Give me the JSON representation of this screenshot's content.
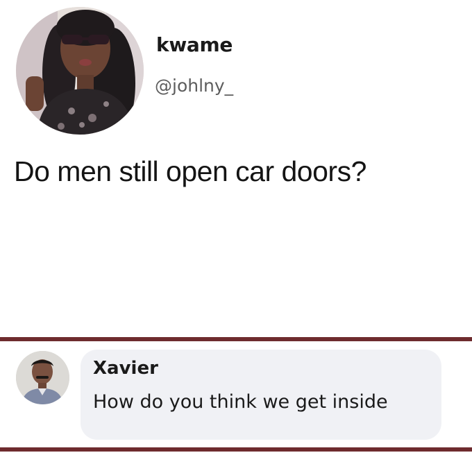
{
  "tweet": {
    "author_name": "kwame",
    "author_handle": "@johlny_",
    "text": "Do men still open car doors?",
    "avatar_icon": "user-avatar-photo"
  },
  "reply": {
    "author_name": "Xavier",
    "text": "How do you think we get inside",
    "avatar_icon": "user-avatar-photo"
  },
  "colors": {
    "divider": "#6e2b2e",
    "comment_bubble": "#f0f1f5",
    "handle_text": "#5d5d5d",
    "primary_text": "#1a1a1a"
  }
}
